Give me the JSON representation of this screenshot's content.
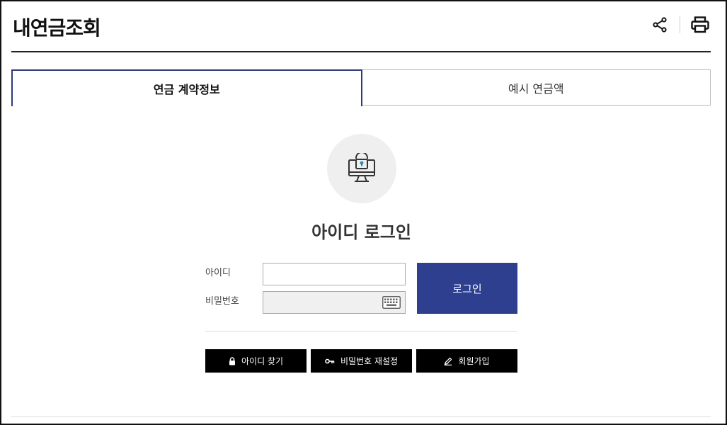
{
  "header": {
    "title": "내연금조회",
    "share_icon": "share-icon",
    "print_icon": "print-icon"
  },
  "tabs": [
    {
      "label": "연금 계약정보",
      "active": true
    },
    {
      "label": "예시 연금액",
      "active": false
    }
  ],
  "login": {
    "icon": "monitor-lock-icon",
    "title": "아이디 로그인",
    "id_label": "아이디",
    "id_value": "",
    "password_label": "비밀번호",
    "password_value": "",
    "keyboard_icon": "virtual-keyboard-icon",
    "submit_label": "로그인"
  },
  "actions": {
    "find_id": "아이디 찾기",
    "reset_password": "비밀번호 재설정",
    "signup": "회원가입"
  },
  "colors": {
    "primary": "#2d3f8e",
    "tab_border": "#2d3a75",
    "action_bg": "#000000"
  }
}
